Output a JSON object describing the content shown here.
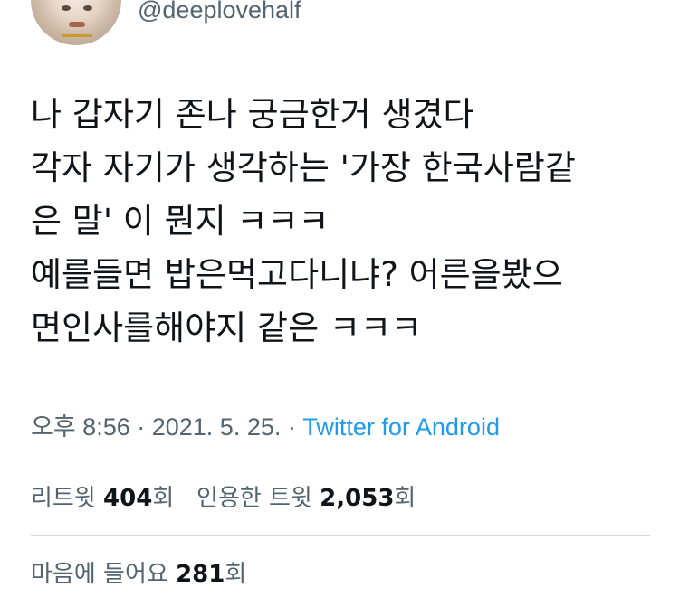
{
  "user": {
    "handle": "@deeplovehalf"
  },
  "tweet": {
    "lines": [
      "나 갑자기 존나 궁금한거 생겼다",
      "각자 자기가 생각하는 '가장 한국사람같",
      "은 말' 이 뭔지 ㅋㅋㅋ",
      "예를들면 밥은먹고다니냐? 어른을봤으",
      "면인사를해야지 같은 ㅋㅋㅋ"
    ]
  },
  "meta": {
    "time": "오후 8:56",
    "sep1": " · ",
    "date": "2021. 5. 25.",
    "sep2": " · ",
    "source": "Twitter for Android"
  },
  "stats": {
    "retweets_label": "리트윗",
    "retweets_count": "404",
    "retweets_unit": "회",
    "quotes_label": "인용한 트윗",
    "quotes_count": "2,053",
    "quotes_unit": "회",
    "likes_label": "마음에 들어요",
    "likes_count": "281",
    "likes_unit": "회"
  },
  "colors": {
    "text": "#0f1419",
    "secondary": "#536471",
    "link": "#1d9bf0",
    "divider": "#cfd9de"
  }
}
